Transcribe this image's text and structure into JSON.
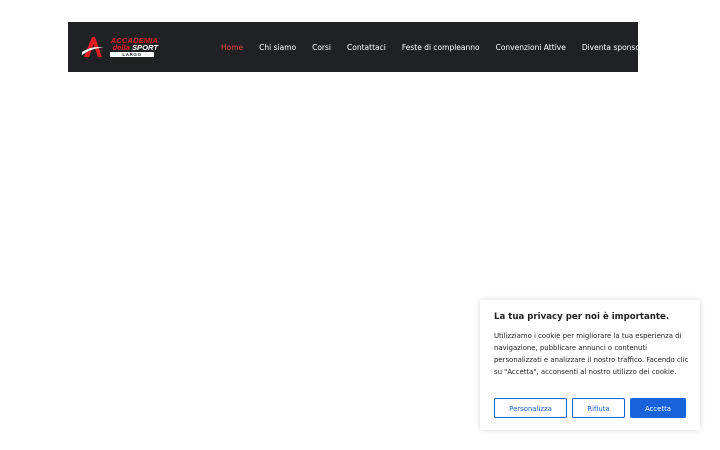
{
  "header": {
    "logo": {
      "line1": "ACCADEMIA",
      "line2_a": "della",
      "line2_b": "SPORT",
      "bar": "LARGO"
    },
    "nav": [
      {
        "label": "Home",
        "active": true
      },
      {
        "label": "Chi siamo",
        "active": false
      },
      {
        "label": "Corsi",
        "active": false
      },
      {
        "label": "Contattaci",
        "active": false
      },
      {
        "label": "Feste di compleanno",
        "active": false
      },
      {
        "label": "Convenzioni Attive",
        "active": false
      },
      {
        "label": "Diventa sponsor",
        "active": false
      }
    ]
  },
  "cookie_banner": {
    "title": "La tua privacy per noi è importante.",
    "body": "Utilizziamo i cookie per migliorare la tua esperienza di navigazione, pubblicare annunci o contenuti personalizzati e analizzare il nostro traffico. Facendo clic su \"Accetta\", acconsenti al nostro utilizzo dei cookie.",
    "buttons": {
      "customize": "Personalizza",
      "reject": "Rifiuta",
      "accept": "Accetta"
    }
  },
  "colors": {
    "header_bg": "#1f2124",
    "accent_red": "#e8473f",
    "logo_red": "#e31d24",
    "button_blue": "#1863dc"
  }
}
